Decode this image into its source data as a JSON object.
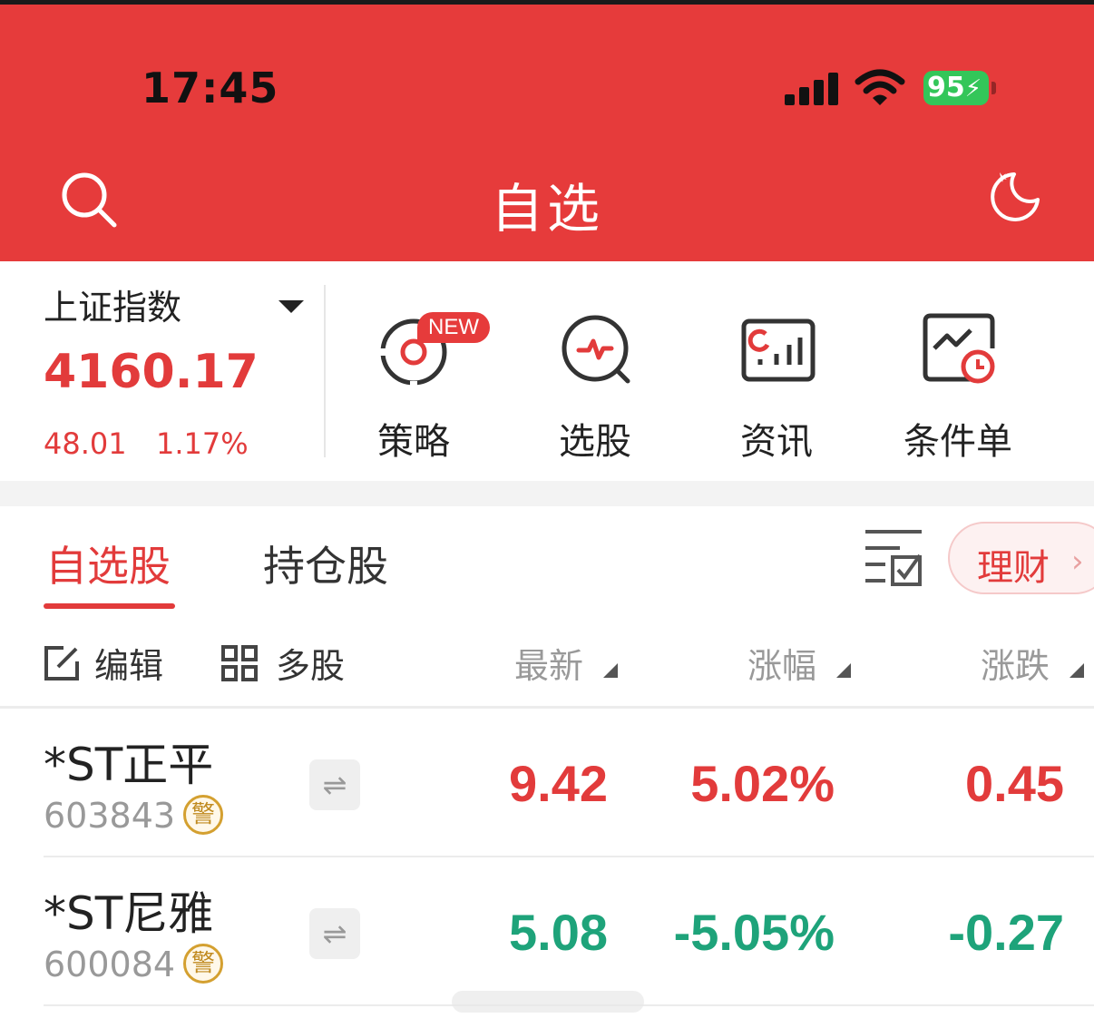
{
  "status_bar": {
    "time": "17:45",
    "battery": "95"
  },
  "header": {
    "title": "自选"
  },
  "index": {
    "name": "上证指数",
    "value": "4160.17",
    "change": "48.01",
    "change_pct": "1.17%"
  },
  "tools": [
    {
      "label": "策略",
      "badge": "NEW",
      "icon": "strategy-icon"
    },
    {
      "label": "选股",
      "icon": "stock-picker-icon"
    },
    {
      "label": "资讯",
      "icon": "news-icon"
    },
    {
      "label": "条件单",
      "icon": "conditional-order-icon"
    }
  ],
  "tabs": [
    {
      "label": "自选股",
      "active": true
    },
    {
      "label": "持仓股",
      "active": false
    }
  ],
  "licai": {
    "label": "理财",
    "chevron": "›"
  },
  "columns": {
    "edit": "编辑",
    "multi": "多股",
    "latest": "最新",
    "change_pct": "涨幅",
    "change": "涨跌"
  },
  "stocks": [
    {
      "name": "*ST正平",
      "code": "603843",
      "warn": "警",
      "swap": "⇌",
      "latest": "9.42",
      "change_pct": "5.02%",
      "change": "0.45",
      "direction": "up"
    },
    {
      "name": "*ST尼雅",
      "code": "600084",
      "warn": "警",
      "swap": "⇌",
      "latest": "5.08",
      "change_pct": "-5.05%",
      "change": "-0.27",
      "direction": "down"
    }
  ],
  "colors": {
    "header_bg": "#e63b3b",
    "up": "#e23b3b",
    "down": "#1ea37a",
    "battery": "#33c659"
  }
}
